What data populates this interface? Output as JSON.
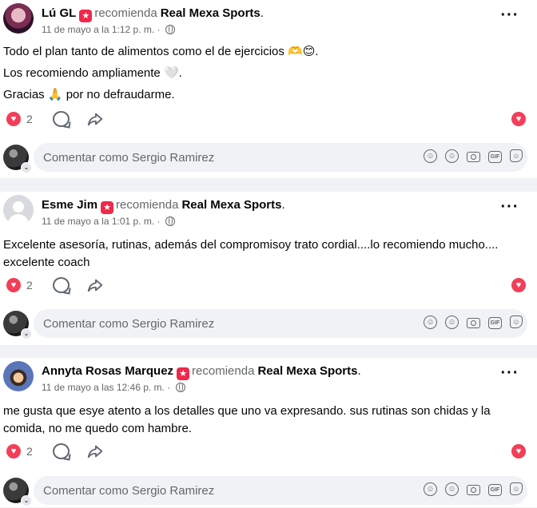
{
  "posts": [
    {
      "author": "Lú GL",
      "recommends_text": "recomienda",
      "page": "Real Mexa Sports",
      "time": "11 de mayo a la 1:12 p. m.",
      "paragraphs": [
        "Todo el plan tanto de alimentos como el de ejercicios 🫶😊.",
        "Los recomiendo ampliamente 🤍.",
        "Gracias 🙏 por no defraudarme."
      ],
      "reactions_count": "2"
    },
    {
      "author": "Esme Jim",
      "recommends_text": "recomienda",
      "page": "Real Mexa Sports",
      "time": "11 de mayo a la 1:01 p. m.",
      "paragraphs": [
        "Excelente asesoría, rutinas, además del  compromisoy trato cordial....lo recomiendo mucho.... excelente coach"
      ],
      "reactions_count": "2"
    },
    {
      "author": "Annyta Rosas Marquez",
      "recommends_text": "recomienda",
      "page": "Real Mexa Sports",
      "time": "11 de mayo a las 12:46 p. m.",
      "paragraphs": [
        "me gusta que esye atento a los detalles que uno va expresando. sus rutinas son chidas y la comida, no me quedo com hambre."
      ],
      "reactions_count": "2"
    }
  ],
  "comment_placeholder": "Comentar como Sergio Ramirez",
  "icons": {
    "recommend": "recommend-star-icon",
    "time_privacy": "globe-icon",
    "more": "more-options-icon",
    "reaction": "love-reaction-icon",
    "comment": "comment-icon",
    "share": "share-icon",
    "emoji": "emoji-icon",
    "camera": "camera-icon",
    "gif": "gif-icon",
    "sticker": "sticker-icon",
    "avatar_story": "avatar-icon"
  },
  "colors": {
    "love": "#f33e58",
    "recommend": "#f02849",
    "secondary_text": "#65676b",
    "background": "#f0f2f5"
  }
}
